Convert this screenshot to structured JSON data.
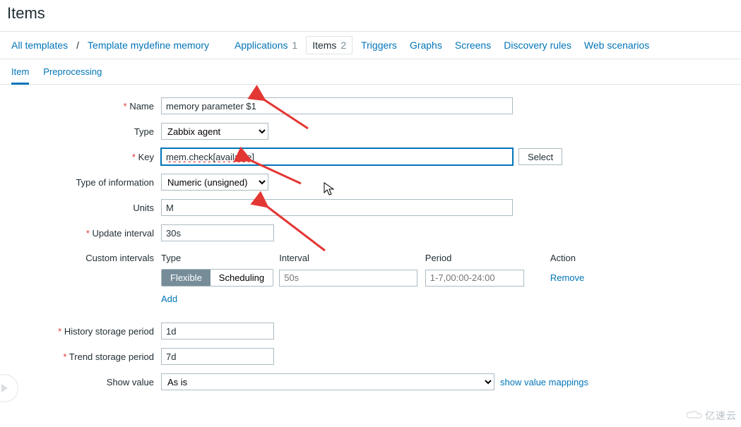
{
  "page": {
    "title": "Items"
  },
  "breadcrumb": {
    "all_templates": "All templates",
    "template_name": "Template mydefine memory",
    "applications": {
      "label": "Applications",
      "count": "1"
    },
    "items": {
      "label": "Items",
      "count": "2"
    },
    "triggers": "Triggers",
    "graphs": "Graphs",
    "screens": "Screens",
    "discovery": "Discovery rules",
    "web": "Web scenarios"
  },
  "subtabs": {
    "item": "Item",
    "preprocessing": "Preprocessing"
  },
  "form": {
    "labels": {
      "name": "Name",
      "type": "Type",
      "key": "Key",
      "info_type": "Type of information",
      "units": "Units",
      "update_interval": "Update interval",
      "custom_intervals": "Custom intervals",
      "history": "History storage period",
      "trend": "Trend storage period",
      "show_value": "Show value"
    },
    "values": {
      "name": "memory parameter $1",
      "type": "Zabbix agent",
      "key": "mem.check[available]",
      "info_type": "Numeric (unsigned)",
      "units": "M",
      "update_interval": "30s",
      "history": "1d",
      "trend": "7d",
      "show_value": "As is"
    },
    "buttons": {
      "select": "Select"
    },
    "intervals": {
      "head": {
        "type": "Type",
        "interval": "Interval",
        "period": "Period",
        "action": "Action"
      },
      "seg": {
        "flexible": "Flexible",
        "scheduling": "Scheduling"
      },
      "placeholders": {
        "interval": "50s",
        "period": "1-7,00:00-24:00"
      },
      "remove": "Remove",
      "add": "Add"
    },
    "show_value_link": "show value mappings"
  },
  "watermark": "亿速云"
}
